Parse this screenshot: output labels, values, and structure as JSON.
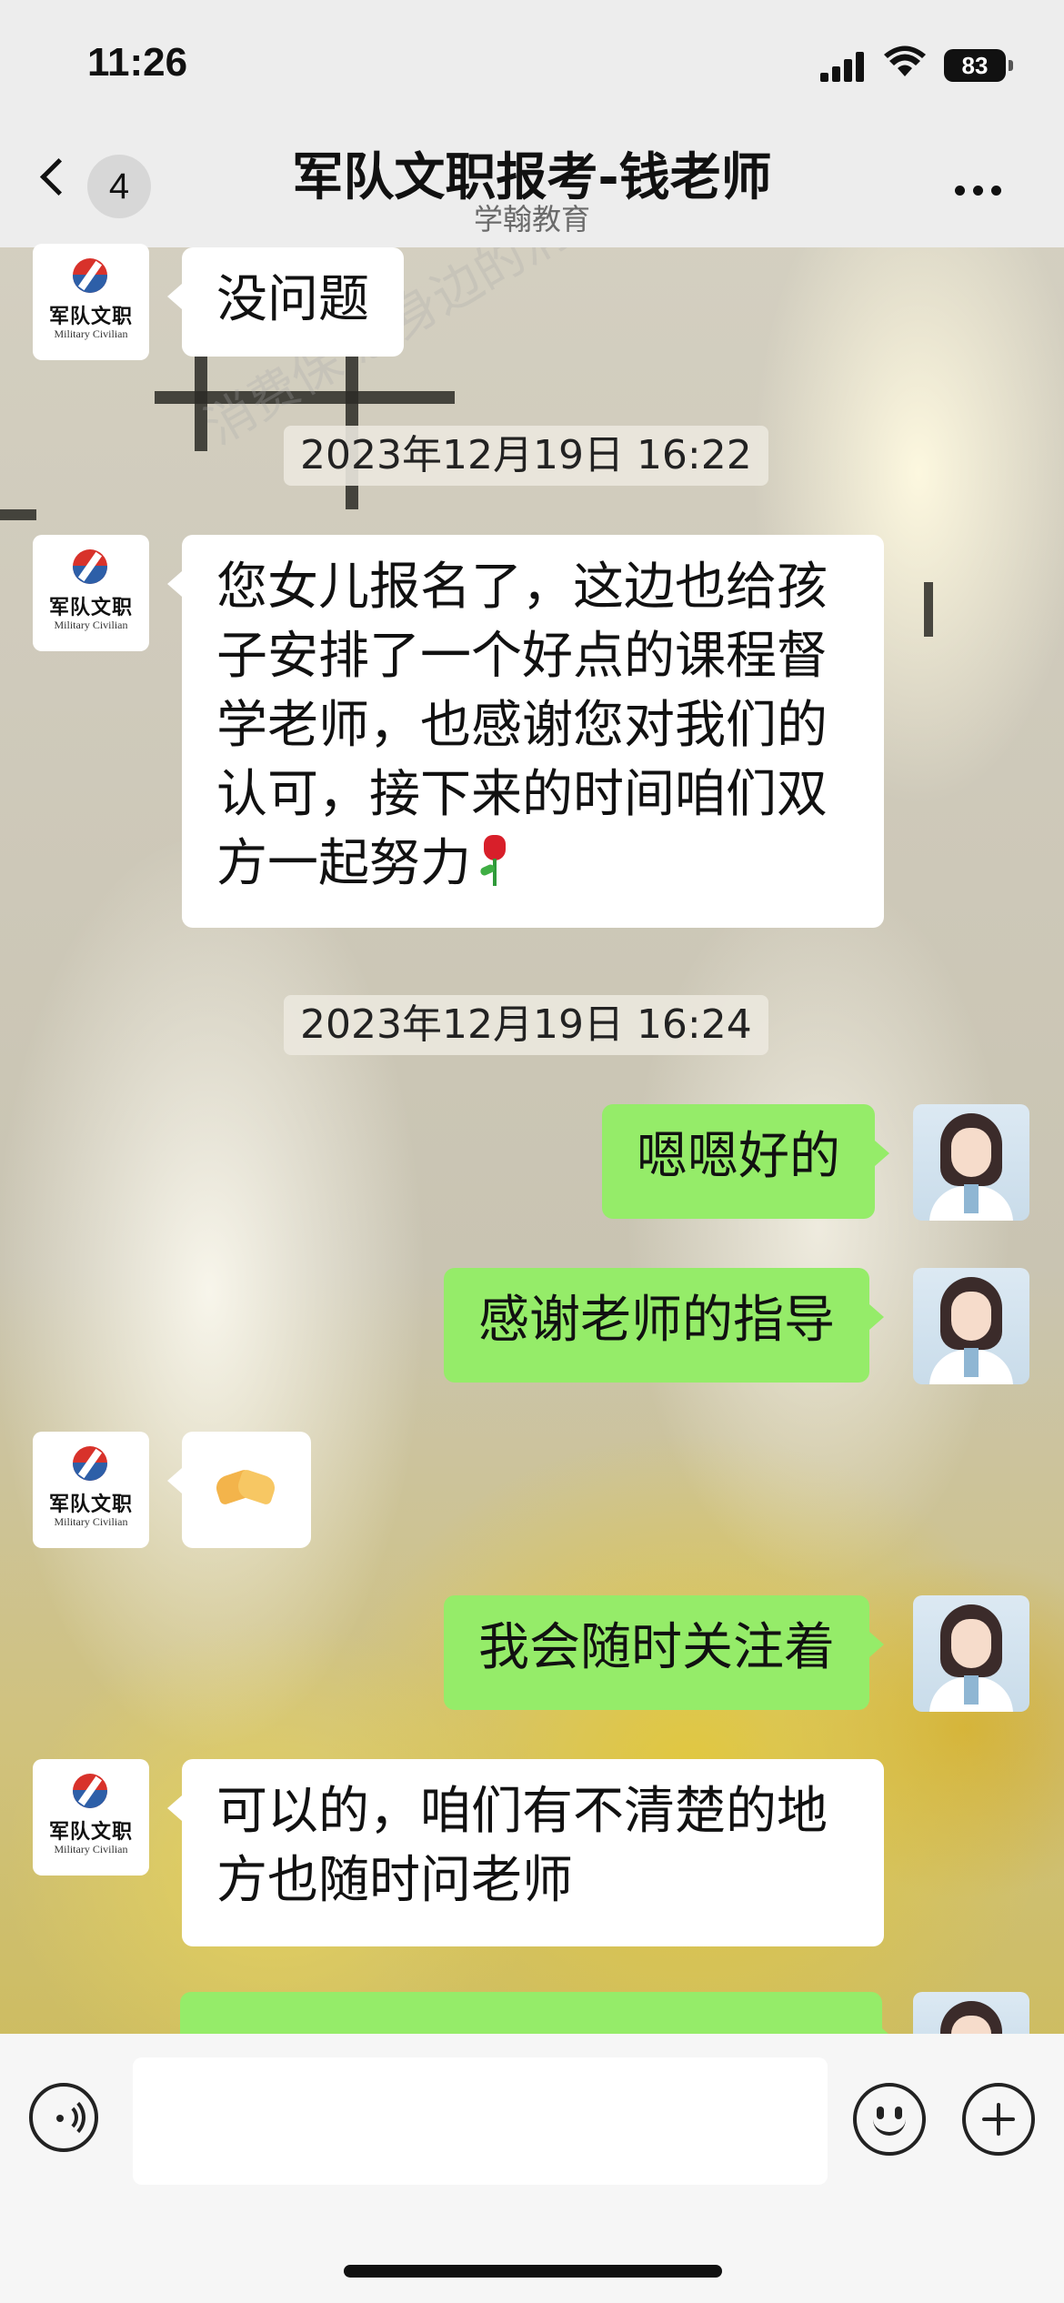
{
  "status_bar": {
    "time": "11:26",
    "battery": "83",
    "icons": [
      "signal-icon",
      "wifi-icon",
      "battery-icon"
    ]
  },
  "header": {
    "back_icon": "chevron-left-icon",
    "unread_count": "4",
    "title": "军队文职报考-钱老师",
    "subtitle": "学翰教育",
    "more_icon": "more-dots-icon"
  },
  "contact_avatar": {
    "brand_cn": "军队文职",
    "brand_en": "Military Civilian"
  },
  "messages": [
    {
      "side": "in",
      "text": "没问题"
    },
    {
      "side": "in",
      "text": "您女儿报名了，这边也给孩子安排了一个好点的课程督学老师，也感谢您对我们的认可，接下来的时间咱们双方一起努力",
      "emoji": "rose-emoji"
    },
    {
      "side": "out",
      "text": "嗯嗯好的"
    },
    {
      "side": "out",
      "text": "感谢老师的指导"
    },
    {
      "side": "in",
      "emoji": "handshake-emoji"
    },
    {
      "side": "out",
      "text": "我会随时关注着"
    },
    {
      "side": "in",
      "text": "可以的，咱们有不清楚的地方也随时问老师"
    }
  ],
  "timestamps": [
    "2023年12月19日 16:22",
    "2023年12月19日 16:24"
  ],
  "message_lines": {
    "m2_line1": "您女儿报名了，这边也给孩",
    "m2_line2": "子安排了一个好点的课程督",
    "m2_line3": "学老师，也感谢您对我们的",
    "m2_line4": "认可，接下来的时间咱们双",
    "m2_line5": "方一起努力",
    "m7_line1": "可以的，咱们有不清楚的地",
    "m7_line2": "方也随时问老师"
  },
  "input_bar": {
    "input_value": "",
    "icons": [
      "voice-icon",
      "emoji-icon",
      "plus-icon"
    ]
  },
  "watermark": [
    "消费保 您身边的消费服务管家"
  ],
  "colors": {
    "outgoing_bubble": "#95ec69",
    "incoming_bubble": "#ffffff",
    "bar_background": "#ededed"
  }
}
